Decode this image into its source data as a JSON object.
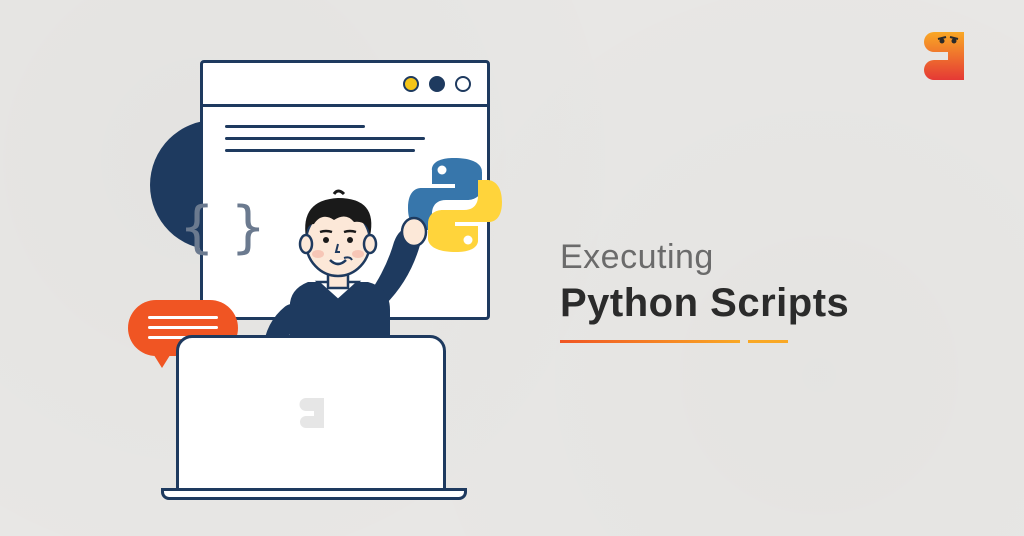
{
  "logo": {
    "name": "coding-ninjas-logo"
  },
  "heading": {
    "line1": "Executing",
    "line2": "Python Scripts"
  },
  "illustration": {
    "description": "Person at laptop with browser window, Python logo, speech bubble and code braces",
    "python_icon": "python-logo",
    "speech_bubble": "chat-bubble-orange",
    "braces_text": "{ }",
    "laptop_logo": "coding-ninjas-logo-small"
  },
  "colors": {
    "background": "#e8e7e5",
    "navy": "#1e3a5f",
    "orange": "#f05523",
    "yellow": "#f5c518",
    "python_blue": "#3776ab",
    "python_yellow": "#ffd43b"
  }
}
